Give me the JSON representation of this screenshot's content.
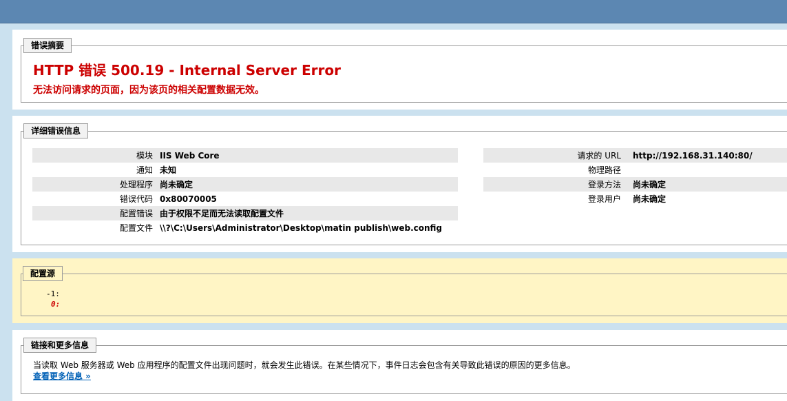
{
  "summary": {
    "legend": "错误摘要",
    "title": "HTTP 错误 500.19 - Internal Server Error",
    "subtitle": "无法访问请求的页面，因为该页的相关配置数据无效。"
  },
  "details": {
    "legend": "详细错误信息",
    "left": [
      {
        "key": "模块",
        "value": "IIS Web Core"
      },
      {
        "key": "通知",
        "value": "未知"
      },
      {
        "key": "处理程序",
        "value": "尚未确定"
      },
      {
        "key": "错误代码",
        "value": "0x80070005"
      },
      {
        "key": "配置错误",
        "value": "由于权限不足而无法读取配置文件"
      },
      {
        "key": "配置文件",
        "value": "\\\\?\\C:\\Users\\Administrator\\Desktop\\matin publish\\web.config"
      }
    ],
    "right": [
      {
        "key": "请求的 URL",
        "value": "http://192.168.31.140:80/"
      },
      {
        "key": "物理路径",
        "value": ""
      },
      {
        "key": "登录方法",
        "value": "尚未确定"
      },
      {
        "key": "登录用户",
        "value": "尚未确定"
      }
    ]
  },
  "config_source": {
    "legend": "配置源",
    "lines": [
      "-1:",
      "0:"
    ]
  },
  "links": {
    "legend": "链接和更多信息",
    "text": "当读取 Web 服务器或 Web 应用程序的配置文件出现问题时，就会发生此错误。在某些情况下，事件日志会包含有关导致此错误的原因的更多信息。",
    "more_link": "查看更多信息 »"
  }
}
